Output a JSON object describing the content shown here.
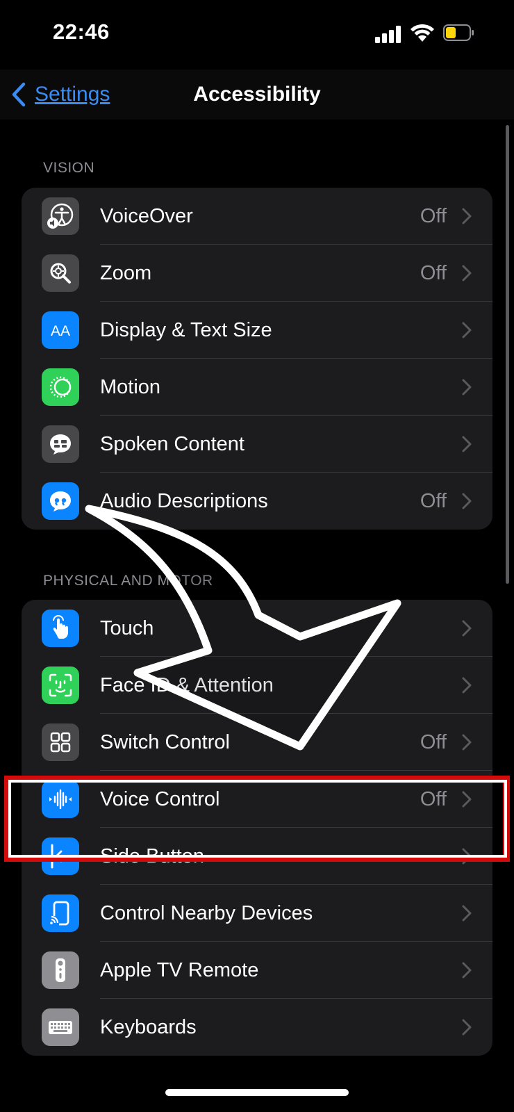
{
  "status": {
    "time": "22:46"
  },
  "nav": {
    "back_label": "Settings",
    "title": "Accessibility"
  },
  "sections": [
    {
      "header": "VISION",
      "items": [
        {
          "label": "VoiceOver",
          "value": "Off",
          "icon": "voiceover-icon",
          "color": "#48484a"
        },
        {
          "label": "Zoom",
          "value": "Off",
          "icon": "zoom-icon",
          "color": "#48484a"
        },
        {
          "label": "Display & Text Size",
          "value": "",
          "icon": "display-text-size-icon",
          "color": "#0a84ff"
        },
        {
          "label": "Motion",
          "value": "",
          "icon": "motion-icon",
          "color": "#30d158"
        },
        {
          "label": "Spoken Content",
          "value": "",
          "icon": "spoken-content-icon",
          "color": "#48484a"
        },
        {
          "label": "Audio Descriptions",
          "value": "Off",
          "icon": "audio-descriptions-icon",
          "color": "#0a84ff"
        }
      ]
    },
    {
      "header": "PHYSICAL AND MOTOR",
      "items": [
        {
          "label": "Touch",
          "value": "",
          "icon": "touch-icon",
          "color": "#0a84ff"
        },
        {
          "label": "Face ID & Attention",
          "value": "",
          "icon": "face-id-icon",
          "color": "#30d158"
        },
        {
          "label": "Switch Control",
          "value": "Off",
          "icon": "switch-control-icon",
          "color": "#48484a"
        },
        {
          "label": "Voice Control",
          "value": "Off",
          "icon": "voice-control-icon",
          "color": "#0a84ff"
        },
        {
          "label": "Side Button",
          "value": "",
          "icon": "side-button-icon",
          "color": "#0a84ff"
        },
        {
          "label": "Control Nearby Devices",
          "value": "",
          "icon": "control-nearby-devices-icon",
          "color": "#0a84ff"
        },
        {
          "label": "Apple TV Remote",
          "value": "",
          "icon": "apple-tv-remote-icon",
          "color": "#8e8e93"
        },
        {
          "label": "Keyboards",
          "value": "",
          "icon": "keyboards-icon",
          "color": "#8e8e93"
        }
      ]
    }
  ],
  "colors": {
    "accent": "#3a8cf2",
    "highlight": "#d40b0b"
  }
}
